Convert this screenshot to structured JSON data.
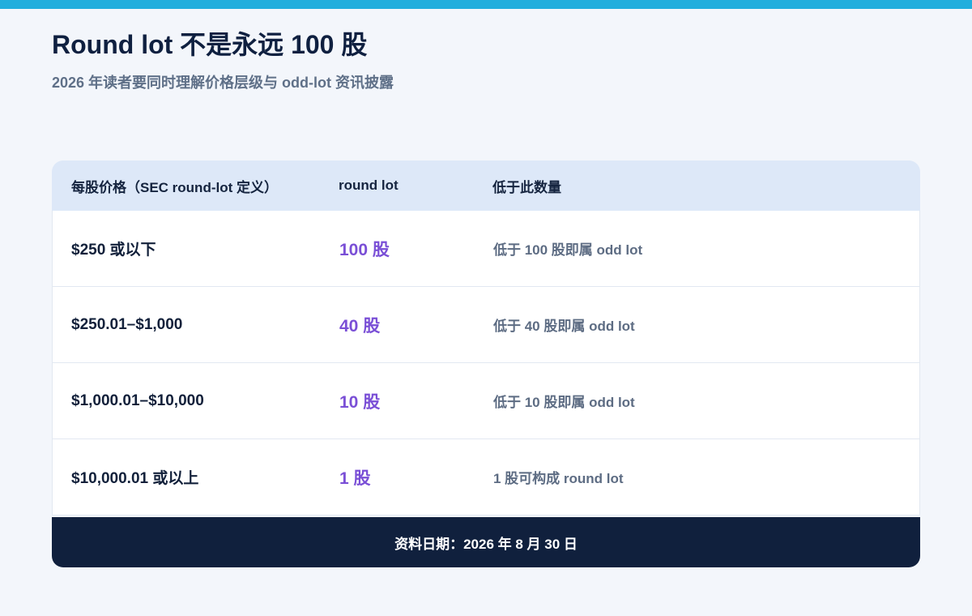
{
  "header": {
    "title": "Round lot 不是永远 100 股",
    "subtitle": "2026 年读者要同时理解价格层级与 odd-lot 资讯披露"
  },
  "table": {
    "columns": [
      "每股价格（SEC round-lot 定义）",
      "round lot",
      "低于此数量"
    ],
    "rows": [
      {
        "price": "$250 或以下",
        "round_lot": "100 股",
        "below": "低于 100 股即属 odd lot"
      },
      {
        "price": "$250.01–$1,000",
        "round_lot": "40 股",
        "below": "低于 40 股即属 odd lot"
      },
      {
        "price": "$1,000.01–$10,000",
        "round_lot": "10 股",
        "below": "低于 10 股即属 odd lot"
      },
      {
        "price": "$10,000.01 或以上",
        "round_lot": "1 股",
        "below": "1 股可构成 round lot"
      }
    ]
  },
  "footer": {
    "date_label": "资料日期：2026 年 8 月 30 日"
  },
  "colors": {
    "accent_bar": "#22aedd",
    "lot_value": "#7a4fd6",
    "footer_bg": "#10203d",
    "header_bg": "#dde8f8"
  }
}
